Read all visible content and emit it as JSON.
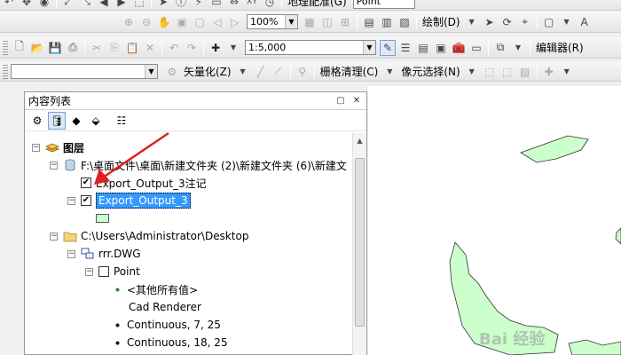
{
  "toolbar1": {
    "menu_label": "地理配准(G)",
    "combo_value": "Point"
  },
  "toolbar2": {
    "zoom_value": "100%",
    "draw_label": "绘制(D)"
  },
  "toolbar3": {
    "scale_value": "1:5,000",
    "editor_label": "编辑器(R)"
  },
  "toolbar4": {
    "vectorize_label": "矢量化(Z)",
    "raster_cleanup_label": "栅格清理(C)",
    "cell_select_label": "像元选择(N)"
  },
  "panel": {
    "title": "内容列表",
    "tree": {
      "root_label": "图层",
      "folder1_path": "F:\\桌面文件\\桌面\\新建文件夹 (2)\\新建文件夹 (6)\\新建文",
      "layer_annotation": "Export_Output_3注记",
      "layer_selected": "Export_Output_3",
      "folder2_path": "C:\\Users\\Administrator\\Desktop",
      "dwg_label": "rrr.DWG",
      "point_label": "Point",
      "other_values": "<其他所有值>",
      "renderer_label": "Cad Renderer",
      "value1": "Continuous, 7, 25",
      "value2": "Continuous, 18, 25"
    }
  },
  "watermark": "Bai 经验",
  "colors": {
    "selection": "#3399ff",
    "polygon_fill": "#ccffcc",
    "arrow": "#e02020"
  }
}
